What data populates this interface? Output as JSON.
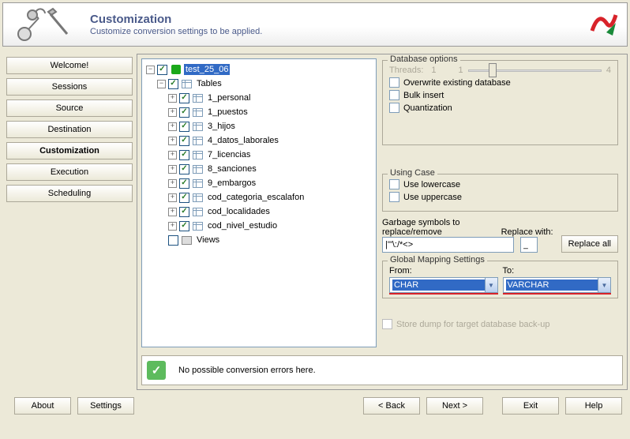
{
  "header": {
    "title": "Customization",
    "subtitle": "Customize conversion settings to be applied."
  },
  "nav": {
    "items": [
      "Welcome!",
      "Sessions",
      "Source",
      "Destination",
      "Customization",
      "Execution",
      "Scheduling"
    ],
    "active": "Customization"
  },
  "tree": {
    "db": "test_25_06",
    "tables_label": "Tables",
    "views_label": "Views",
    "tables": [
      "1_personal",
      "1_puestos",
      "3_hijos",
      "4_datos_laborales",
      "7_licencias",
      "8_sanciones",
      "9_embargos",
      "cod_categoria_escalafon",
      "cod_localidades",
      "cod_nivel_estudio"
    ]
  },
  "opts": {
    "db_group": "Database options",
    "threads_label": "Threads:",
    "threads_cur": "1",
    "threads_min": "1",
    "threads_max": "4",
    "overwrite": "Overwrite existing database",
    "bulk": "Bulk insert",
    "quant": "Quantization",
    "case_group": "Using Case",
    "lower": "Use lowercase",
    "upper": "Use uppercase",
    "garbage_label": "Garbage symbols to replace/remove",
    "garbage_value": "|'\"\\:/*<>",
    "replace_label": "Replace with:",
    "replace_value": "_",
    "replace_btn": "Replace all",
    "map_group": "Global Mapping Settings",
    "from_label": "From:",
    "to_label": "To:",
    "from_value": "CHAR",
    "to_value": "VARCHAR",
    "dump": "Store dump for target database back-up"
  },
  "status": "No possible conversion errors here.",
  "footer": {
    "about": "About",
    "settings": "Settings",
    "back": "< Back",
    "next": "Next >",
    "exit": "Exit",
    "help": "Help"
  }
}
